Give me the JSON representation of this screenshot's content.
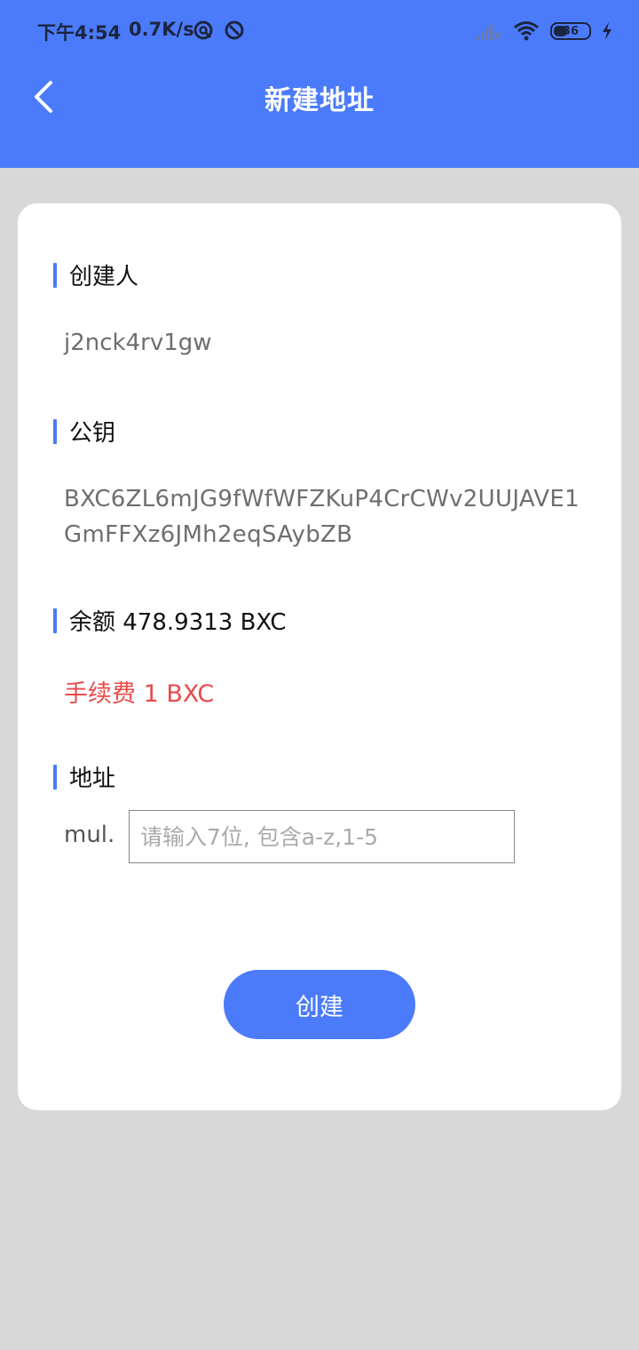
{
  "status_bar": {
    "time": "下午4:54",
    "speed": "0.7K/s",
    "battery": "36"
  },
  "header": {
    "title": "新建地址"
  },
  "form": {
    "creator_label": "创建人",
    "creator_value": "j2nck4rv1gw",
    "pubkey_label": "公钥",
    "pubkey_value": "BXC6ZL6mJG9fWfWFZKuP4CrCWv2UUJAVE1GmFFXz6JMh2eqSAybZB",
    "balance_label": "余额 478.9313 BXC",
    "fee_text": "手续费 1 BXC",
    "address_label": "地址",
    "address_prefix": "mul.",
    "address_placeholder": "请输入7位, 包含a-z,1-5",
    "address_value": "",
    "create_button": "创建"
  },
  "colors": {
    "accent": "#4b7bfa",
    "fee": "#e84b4b",
    "background": "#d8d8d8"
  }
}
